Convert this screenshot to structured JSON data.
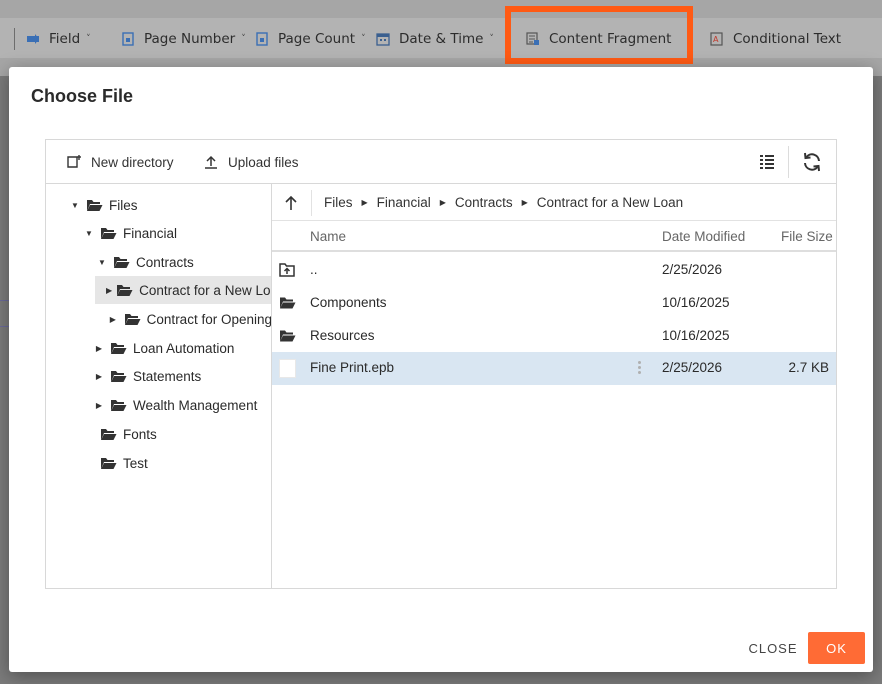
{
  "toolbar": {
    "items": [
      {
        "label": "Field",
        "caret": "˅"
      },
      {
        "label": "Page Number",
        "caret": "˅"
      },
      {
        "label": "Page Count",
        "caret": "˅"
      },
      {
        "label": "Date & Time",
        "caret": "˅"
      },
      {
        "label": "Content Fragment"
      },
      {
        "label": "Conditional Text"
      }
    ],
    "highlight_color": "#ff5a14"
  },
  "dialog": {
    "title": "Choose File",
    "toolbar": {
      "new_directory": "New directory",
      "upload_files": "Upload files",
      "icons": [
        "new-folder-icon",
        "upload-icon",
        "details-view-icon",
        "refresh-icon"
      ]
    },
    "tree": {
      "items": [
        {
          "label": "Files",
          "arrow": "▼"
        },
        {
          "label": "Financial",
          "arrow": "▼"
        },
        {
          "label": "Contracts",
          "arrow": "▼"
        },
        {
          "label": "Contract for a New Loan",
          "arrow": "▶",
          "selected": true
        },
        {
          "label": "Contract for Opening",
          "arrow": "▶"
        },
        {
          "label": "Loan Automation",
          "arrow": "▶"
        },
        {
          "label": "Statements",
          "arrow": "▶"
        },
        {
          "label": "Wealth Management",
          "arrow": "▶"
        },
        {
          "label": "Fonts",
          "arrow": ""
        },
        {
          "label": "Test",
          "arrow": ""
        }
      ]
    },
    "breadcrumb": [
      "Files",
      "Financial",
      "Contracts",
      "Contract for a New Loan"
    ],
    "columns": {
      "name": "Name",
      "date": "Date Modified",
      "size": "File Size"
    },
    "rows": [
      {
        "name": "..",
        "date": "2/25/2026",
        "size": "",
        "icon": "parent-folder-icon"
      },
      {
        "name": "Components",
        "date": "10/16/2025",
        "size": "",
        "icon": "folder-icon"
      },
      {
        "name": "Resources",
        "date": "10/16/2025",
        "size": "",
        "icon": "folder-icon"
      },
      {
        "name": "Fine Print.epb",
        "date": "2/25/2026",
        "size": "2.7 KB",
        "icon": "file-icon",
        "selected": true
      }
    ],
    "footer": {
      "close": "CLOSE",
      "ok": "OK"
    },
    "accent_color": "#ff6b35",
    "selection_color": "#d9e6f2"
  }
}
